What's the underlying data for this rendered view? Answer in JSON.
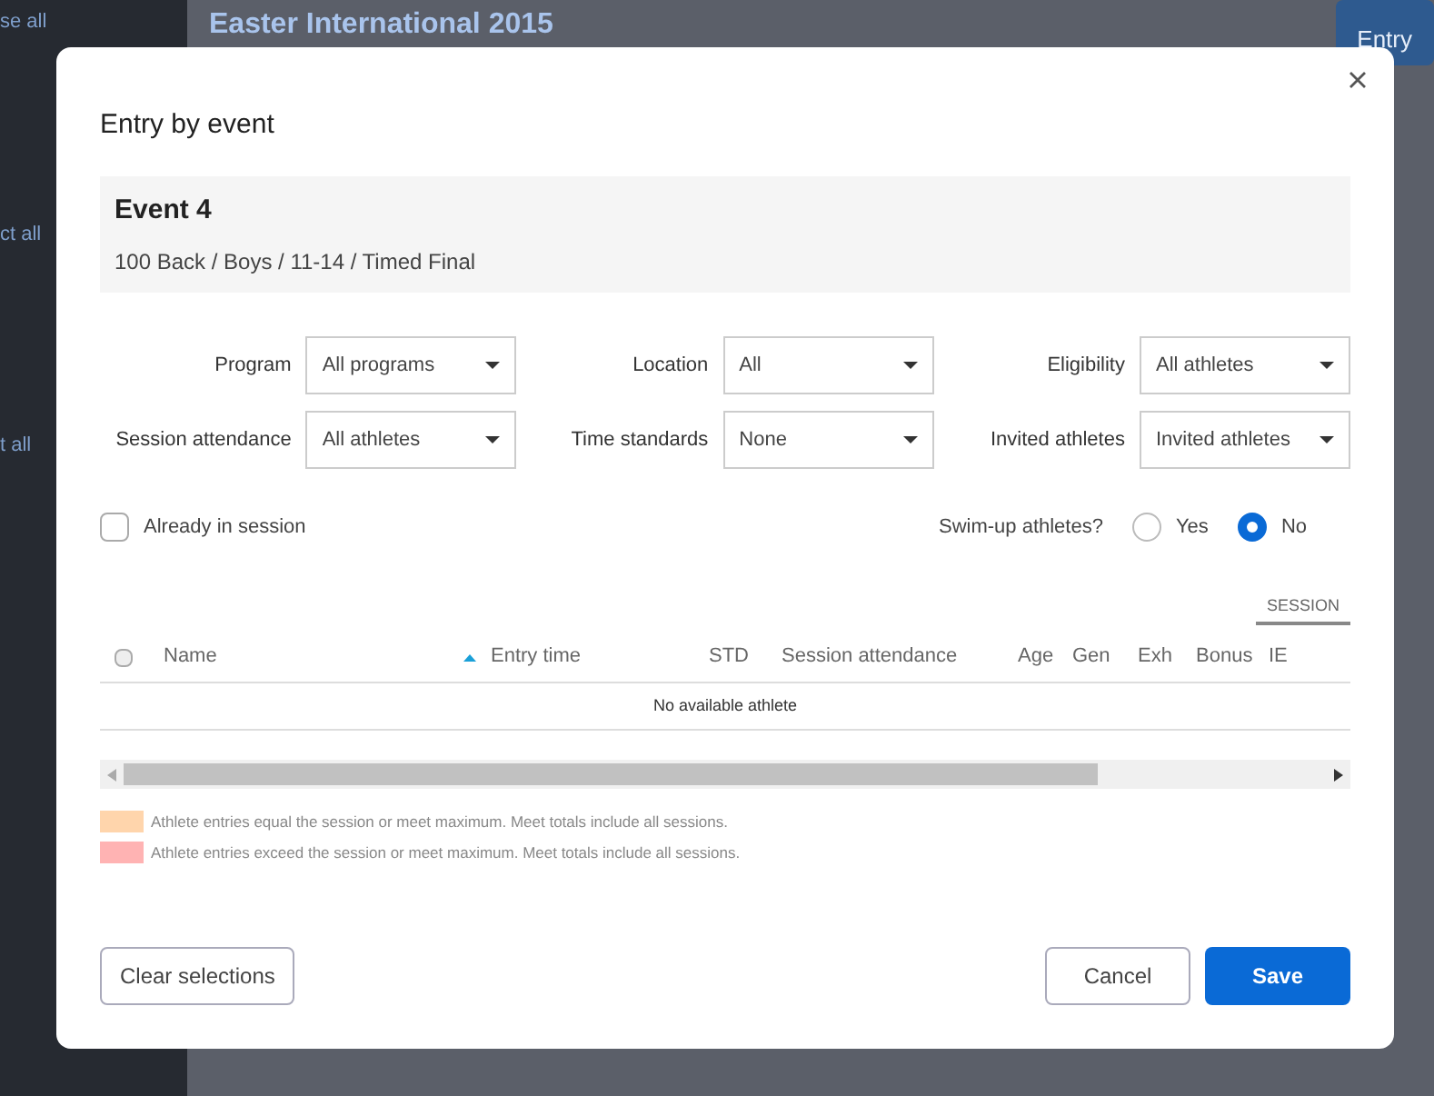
{
  "background": {
    "sidebar_texts": [
      "se all",
      "ct all",
      "t all"
    ],
    "page_title": "Easter International 2015",
    "page_button": "Entry"
  },
  "dialog": {
    "title": "Entry by event",
    "event": {
      "name": "Event 4",
      "description": "100 Back / Boys / 11-14 / Timed Final"
    },
    "filters": [
      {
        "label": "Program",
        "value": "All programs"
      },
      {
        "label": "Location",
        "value": "All"
      },
      {
        "label": "Eligibility",
        "value": "All athletes"
      },
      {
        "label": "Session attendance",
        "value": "All athletes"
      },
      {
        "label": "Time standards",
        "value": "None"
      },
      {
        "label": "Invited athletes",
        "value": "Invited athletes"
      }
    ],
    "already_in_session": {
      "label": "Already in session",
      "checked": false
    },
    "swim_up": {
      "label": "Swim-up athletes?",
      "options": [
        {
          "label": "Yes",
          "selected": false
        },
        {
          "label": "No",
          "selected": true
        }
      ]
    },
    "table": {
      "group_header": "SESSION",
      "select_all": {
        "checked": false
      },
      "columns": [
        {
          "label": "Name",
          "sorted": true
        },
        {
          "label": "Entry time",
          "sorted": false
        },
        {
          "label": "STD",
          "sorted": false
        },
        {
          "label": "Session attendance",
          "sorted": false
        },
        {
          "label": "Age",
          "sorted": false
        },
        {
          "label": "Gen",
          "sorted": false
        },
        {
          "label": "Exh",
          "sorted": false
        },
        {
          "label": "Bonus",
          "sorted": false
        },
        {
          "label": "IE",
          "sorted": false
        }
      ],
      "empty_message": "No available athlete"
    },
    "legend": [
      {
        "color": "#ffd5ac",
        "text": "Athlete entries equal the session or meet maximum. Meet totals include all sessions."
      },
      {
        "color": "#ffb3b3",
        "text": "Athlete entries exceed the session or meet maximum. Meet totals include all sessions."
      }
    ],
    "buttons": {
      "clear": "Clear selections",
      "cancel": "Cancel",
      "save": "Save"
    }
  }
}
